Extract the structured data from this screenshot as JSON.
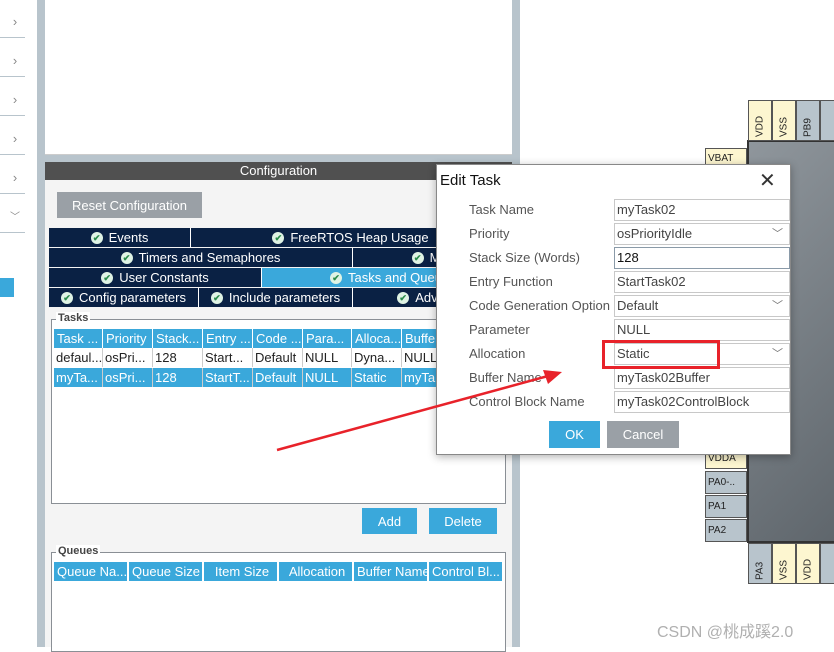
{
  "sidebar": {
    "chevrons": [
      "right",
      "right",
      "right",
      "right",
      "right",
      "down"
    ]
  },
  "config": {
    "header": "Configuration",
    "reset_label": "Reset Configuration",
    "tabs": [
      {
        "label": "Events"
      },
      {
        "label": "FreeRTOS Heap Usage"
      },
      {
        "label": "Timers and Semaphores"
      },
      {
        "label": "Mut"
      },
      {
        "label": "User Constants"
      },
      {
        "label": "Tasks and Queu",
        "active": true
      },
      {
        "label": "Config parameters"
      },
      {
        "label": "Include parameters"
      },
      {
        "label": "Advance"
      }
    ],
    "tasks": {
      "title": "Tasks",
      "columns": [
        "Task ...",
        "Priority",
        "Stack...",
        "Entry ...",
        "Code ...",
        "Para...",
        "Alloca...",
        "Buffe"
      ],
      "rows": [
        [
          "defaul...",
          "osPri...",
          "128",
          "Start...",
          "Default",
          "NULL",
          "Dyna...",
          "NULL"
        ],
        [
          "myTa...",
          "osPri...",
          "128",
          "StartT...",
          "Default",
          "NULL",
          "Static",
          "myTa"
        ]
      ],
      "selected_row": 1
    },
    "add_label": "Add",
    "delete_label": "Delete",
    "queues": {
      "title": "Queues",
      "columns": [
        "Queue Na...",
        "Queue Size",
        "Item Size",
        "Allocation",
        "Buffer Name",
        "Control Bl..."
      ]
    }
  },
  "dialog": {
    "title": "Edit Task",
    "fields": [
      {
        "label": "Task Name",
        "value": "myTask02"
      },
      {
        "label": "Priority",
        "value": "osPriorityIdle",
        "dropdown": true
      },
      {
        "label": "Stack Size (Words)",
        "value": "128"
      },
      {
        "label": "Entry Function",
        "value": "StartTask02"
      },
      {
        "label": "Code Generation Option",
        "value": "Default",
        "dropdown": true
      },
      {
        "label": "Parameter",
        "value": "NULL"
      },
      {
        "label": "Allocation",
        "value": "Static",
        "dropdown": true
      },
      {
        "label": "Buffer Name",
        "value": "myTask02Buffer"
      },
      {
        "label": "Control Block Name",
        "value": "myTask02ControlBlock"
      }
    ],
    "ok_label": "OK",
    "cancel_label": "Cancel"
  },
  "chip": {
    "top_pins": [
      "VDD",
      "VSS",
      "PB9"
    ],
    "left_pins": [
      "VBAT",
      "VDDA",
      "PA0-..",
      "PA1",
      "PA2"
    ],
    "bottom_pins": [
      "PA3",
      "VSS",
      "VDD"
    ]
  },
  "annotation_color": "#e8222a",
  "watermark": "CSDN @桃成蹊2.0"
}
